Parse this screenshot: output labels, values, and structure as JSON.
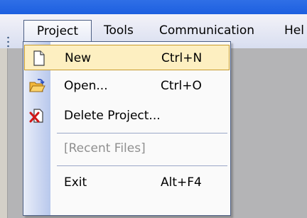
{
  "menubar": {
    "menus": [
      {
        "label": "Project",
        "active": true
      },
      {
        "label": "Tools"
      },
      {
        "label": "Communication"
      },
      {
        "label": "Hel"
      }
    ]
  },
  "project_menu": {
    "items": [
      {
        "label": "New",
        "shortcut": "Ctrl+N",
        "icon": "new-file-icon",
        "highlighted": true
      },
      {
        "label": "Open...",
        "shortcut": "Ctrl+O",
        "icon": "open-folder-icon"
      },
      {
        "label": "Delete Project...",
        "shortcut": "",
        "icon": "delete-project-icon"
      },
      {
        "label": "[Recent Files]",
        "shortcut": "",
        "disabled": true
      },
      {
        "label": "Exit",
        "shortcut": "Alt+F4"
      }
    ]
  },
  "colors": {
    "title_bar": "#1d5fe0",
    "highlight_fill": "#fdefc1",
    "highlight_border": "#c79a2a",
    "workspace": "#b4b4b6",
    "disabled_text": "#8f8f8f"
  }
}
